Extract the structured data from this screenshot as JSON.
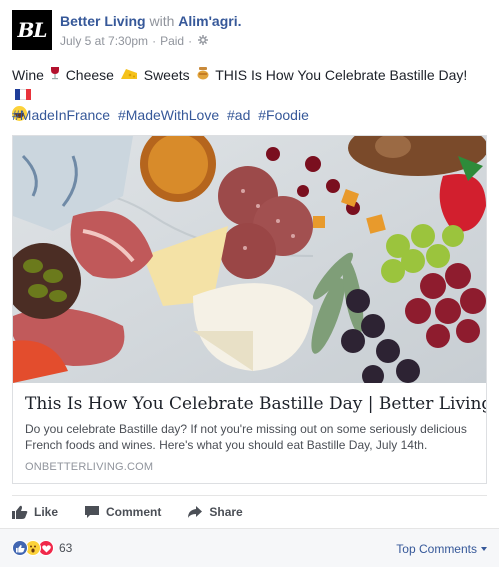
{
  "post": {
    "avatar_text": "BL",
    "page_name": "Better Living",
    "with_text": "with",
    "partner_name": "Alim'agri.",
    "date": "July 5 at 7:30pm",
    "sponsor_label": "Paid",
    "separator": "·",
    "text": {
      "w1": "Wine",
      "w2": "Cheese",
      "w3": "Sweets",
      "w4": "THIS Is How You Celebrate Bastille Day!"
    },
    "hashtags": [
      "#MadeInFrance",
      "#MadeWithLove",
      "#ad",
      "#Foodie"
    ]
  },
  "link_card": {
    "title": "This Is How You Celebrate Bastille Day | Better Living",
    "description": "Do you celebrate Bastille day? If not you're missing out on some seriously delicious French foods and wines. Here's what you should eat Bastille Day, July 14th.",
    "domain": "ONBETTERLIVING.COM"
  },
  "actions": {
    "like": "Like",
    "comment": "Comment",
    "share": "Share"
  },
  "footer": {
    "reaction_count": "63",
    "top_comments": "Top Comments"
  },
  "colors": {
    "link_blue": "#365899",
    "muted": "#90949c",
    "like_blue": "#4267b2",
    "love_red": "#f0284a",
    "wow_yellow": "#fcd23b"
  }
}
